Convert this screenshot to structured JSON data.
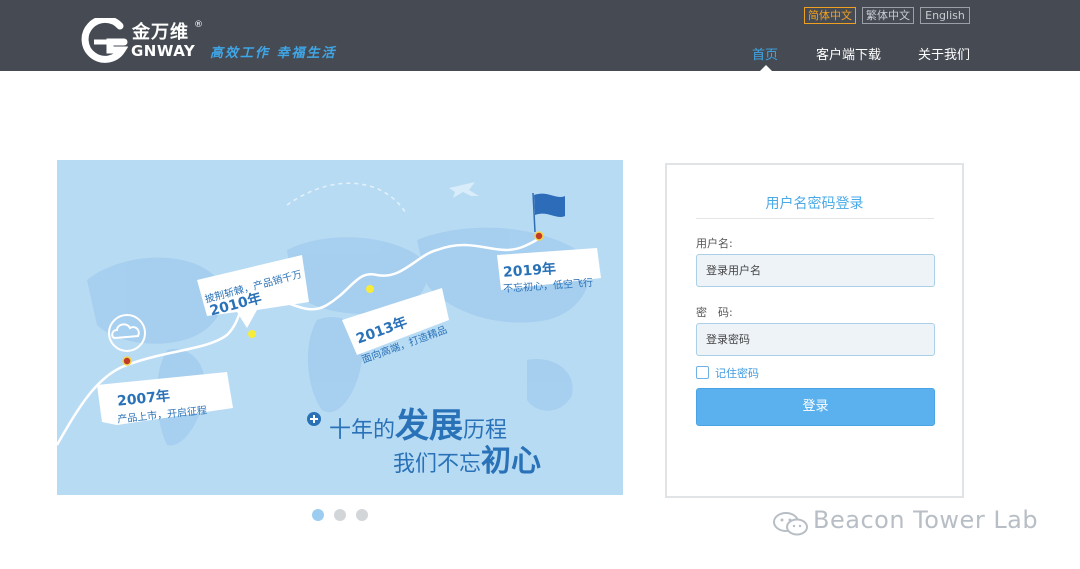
{
  "header": {
    "brand_cn": "金万维",
    "brand_reg": "®",
    "brand_en": "GNWAY",
    "slogan": "高效工作 幸福生活",
    "languages": [
      {
        "label": "简体中文",
        "active": true
      },
      {
        "label": "繁体中文",
        "active": false
      },
      {
        "label": "English",
        "active": false
      }
    ],
    "nav": [
      {
        "label": "首页",
        "active": true
      },
      {
        "label": "客户端下载",
        "active": false
      },
      {
        "label": "关于我们",
        "active": false
      }
    ]
  },
  "banner": {
    "milestones": [
      {
        "year": "2007年",
        "text": "产品上市，开启征程"
      },
      {
        "year": "2010年",
        "text": "披荆斩棘，产品销千万"
      },
      {
        "year": "2013年",
        "text": "面向高端，打造精品"
      },
      {
        "year": "2019年",
        "text": "不忘初心，低空飞行"
      }
    ],
    "headline_1": "十年的",
    "headline_1_big": "发展",
    "headline_1_end": "历程",
    "headline_2": "我们不忘",
    "headline_2_big": "初心",
    "slide_count": 3,
    "active_slide": 1
  },
  "login": {
    "title": "用户名密码登录",
    "username_label": "用户名:",
    "username_placeholder": "登录用户名",
    "password_label": "密　码:",
    "password_placeholder": "登录密码",
    "remember_label": "记住密码",
    "submit_label": "登录"
  },
  "watermark": "Beacon Tower Lab",
  "colors": {
    "header_bg": "#464b53",
    "accent": "#3fa6e8",
    "lang_active": "#f0a020",
    "button": "#5bb1ee"
  }
}
